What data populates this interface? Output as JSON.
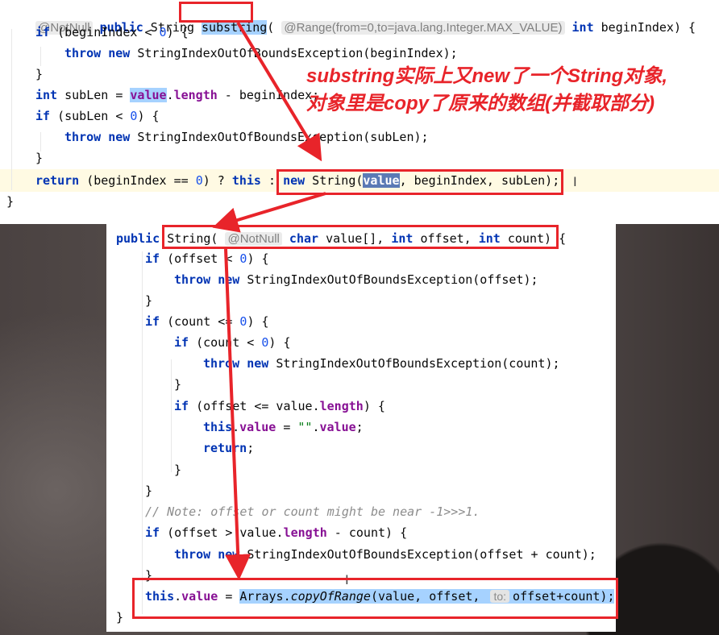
{
  "top_code": {
    "line1": {
      "anno": "@NotNull",
      "kw_public": "public",
      "type": "String",
      "method": "substring",
      "range_anno": "@Range(from=0,to=java.lang.Integer.MAX_VALUE)",
      "kw_int": "int",
      "param": "beginIndex) {"
    },
    "line2": {
      "kw_if": "if",
      "cond_a": "(beginIndex < ",
      "zero": "0",
      "cond_b": ") {"
    },
    "line3": {
      "kw_throw": "throw",
      "kw_new": "new",
      "rest": "StringIndexOutOfBoundsException(beginIndex);"
    },
    "line4": "}",
    "line5": {
      "kw_int": "int",
      "a": "subLen = ",
      "value": "value",
      "dot": ".",
      "length": "length",
      "b": " - beginIndex;"
    },
    "line6": {
      "kw_if": "if",
      "a": "(subLen < ",
      "zero": "0",
      "b": ") {"
    },
    "line7": {
      "kw_throw": "throw",
      "kw_new": "new",
      "rest": "StringIndexOutOfBoundsException(subLen);"
    },
    "line8": "}",
    "line9": {
      "kw_return": "return",
      "a": "(beginIndex == ",
      "zero": "0",
      "b": ") ? ",
      "kw_this": "this",
      "c": " : ",
      "kw_new": "new",
      "d": " String(",
      "value": "value",
      "e": ", beginIndex, subLen);"
    },
    "line10": "}"
  },
  "caption": {
    "line1": "substring实际上又new了一个String对象,",
    "line2": "对象里是copy了原来的数组(并截取部分)"
  },
  "bottom_code": {
    "l1": {
      "kw_public": "public",
      "a": "String(",
      "anno": "@NotNull",
      "kw_char": "char",
      "b": "value[], ",
      "kw_int1": "int",
      "c": "offset, ",
      "kw_int2": "int",
      "d": "count) {"
    },
    "l2": {
      "kw_if": "if",
      "a": "(offset < ",
      "zero": "0",
      "b": ") {"
    },
    "l3": {
      "kw_throw": "throw",
      "kw_new": "new",
      "rest": "StringIndexOutOfBoundsException(offset);"
    },
    "l4": "}",
    "l5": {
      "kw_if": "if",
      "a": "(count <= ",
      "zero": "0",
      "b": ") {"
    },
    "l6": {
      "kw_if": "if",
      "a": "(count < ",
      "zero": "0",
      "b": ") {"
    },
    "l7": {
      "kw_throw": "throw",
      "kw_new": "new",
      "rest": "StringIndexOutOfBoundsException(count);"
    },
    "l8": "}",
    "l9": {
      "kw_if": "if",
      "a": "(offset <= value.",
      "length": "length",
      "b": ") {"
    },
    "l10": {
      "kw_this": "this",
      "dot": ".",
      "value": "value",
      "a": " = ",
      "str": "\"\"",
      "dot2": ".",
      "value2": "value",
      "b": ";"
    },
    "l11": {
      "kw_return": "return",
      "b": ";"
    },
    "l12": "}",
    "l13": "}",
    "l14": "// Note: offset or count might be near -1>>>1.",
    "l15": {
      "kw_if": "if",
      "a": "(offset > value.",
      "length": "length",
      "b": " - count) {"
    },
    "l16": {
      "kw_throw": "throw",
      "kw_new": "new",
      "rest": "StringIndexOutOfBoundsException(offset + count);"
    },
    "l17": "}",
    "l18": {
      "kw_this": "this",
      "dot": ".",
      "value": "value",
      "a": " = ",
      "call_a": "Arrays.",
      "call_b": "copyOfRange",
      "b": "(value, offset, ",
      "hint": "to:",
      "c": "offset+count);"
    },
    "l19": "}"
  },
  "colors": {
    "keyword": "#0033b3",
    "field": "#871094",
    "number": "#1750eb",
    "annotation_red": "#e8242a",
    "selection": "#a6d2ff"
  }
}
